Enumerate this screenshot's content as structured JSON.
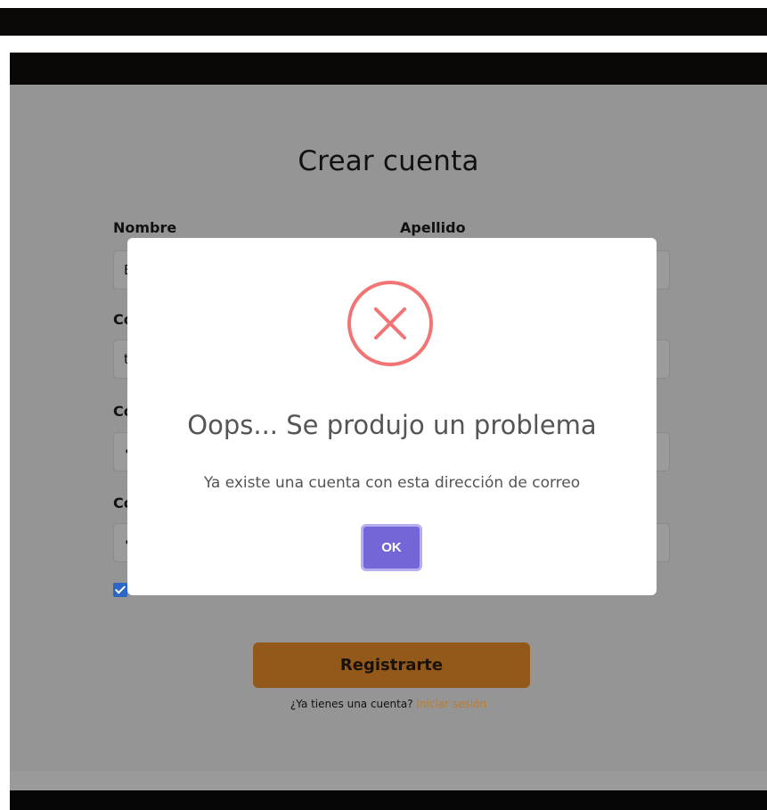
{
  "form": {
    "title": "Crear cuenta",
    "nombre_label": "Nombre",
    "apellido_label": "Apellido",
    "nombre_value": "E",
    "row2_label": "Co",
    "row2_value": "t",
    "row3_label": "Co",
    "row3_value": "•",
    "row4_label": "Co",
    "row4_value": "•",
    "checkbox_checked": true,
    "register_label": "Registrarte",
    "login_prompt": "¿Ya tienes una cuenta?",
    "login_link": "Iniciar sesión"
  },
  "modal": {
    "icon": "error-x-icon",
    "title": "Oops... Se produjo un problema",
    "message": "Ya existe una cuenta con esta dirección de correo",
    "ok_label": "OK"
  },
  "colors": {
    "error": "#f27474",
    "ok_button": "#7367d8",
    "register_button": "#93591a",
    "link": "#c07a2c",
    "checkbox": "#2d66c5"
  }
}
